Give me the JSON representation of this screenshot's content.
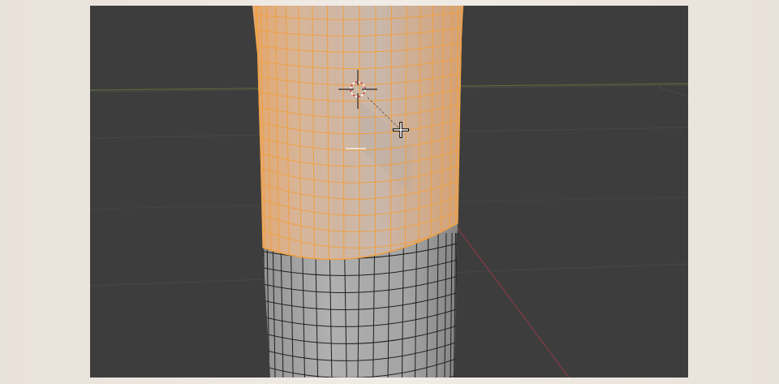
{
  "app": {
    "name": "3D viewport",
    "mode": "edit-mode"
  },
  "viewport": {
    "background_color": "#3d3d3d",
    "grid_color": "#484848",
    "x_axis_color": "#8a3a46",
    "y_axis_color": "#5c6b3a"
  },
  "mesh": {
    "object": "cylinder",
    "selected_faces_color": "#d9b48f",
    "selected_edge_color": "#f0a040",
    "unselected_face_color": "#9a9a9a",
    "unselected_edge_color": "#1e1e1e",
    "selection": "upper-ring-loops"
  },
  "cursor": {
    "type": "3d-cursor",
    "icon": "crosshair-icon"
  },
  "mouse": {
    "icon": "move-cursor-icon"
  }
}
